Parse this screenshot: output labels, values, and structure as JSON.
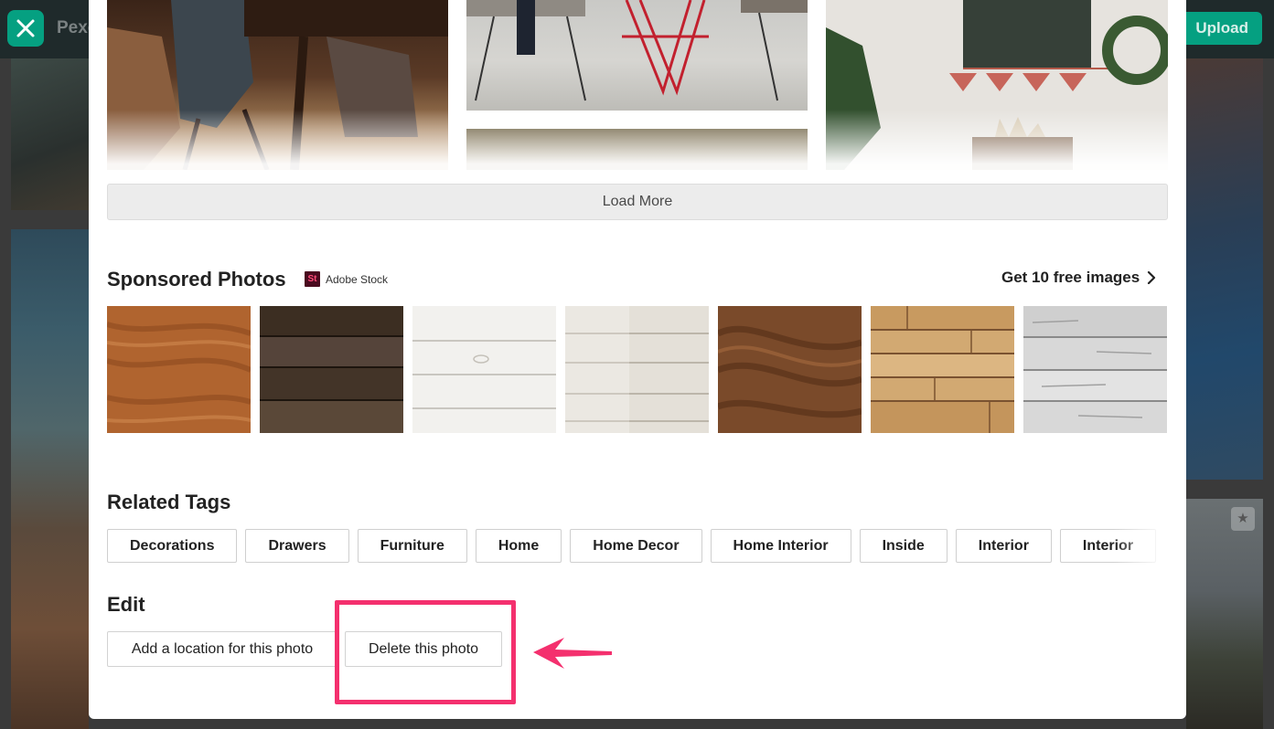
{
  "background": {
    "logo_text": "Pexe",
    "upload_label": "Upload"
  },
  "modal": {
    "close_icon": "close-icon",
    "load_more_label": "Load More",
    "sponsored": {
      "title": "Sponsored Photos",
      "provider_icon_text": "St",
      "provider": "Adobe Stock",
      "cta_label": "Get 10 free images",
      "thumbnails": [
        {
          "label": "warm oak wood texture"
        },
        {
          "label": "dark weathered planks"
        },
        {
          "label": "white painted planks"
        },
        {
          "label": "light grey planks"
        },
        {
          "label": "walnut wood grain"
        },
        {
          "label": "natural pine planks"
        },
        {
          "label": "grey rustic planks"
        }
      ]
    },
    "related_tags": {
      "title": "Related Tags",
      "tags": [
        "Decorations",
        "Drawers",
        "Furniture",
        "Home",
        "Home Decor",
        "Home Interior",
        "Inside",
        "Interior",
        "Interior"
      ]
    },
    "edit": {
      "title": "Edit",
      "add_location_label": "Add a location for this photo",
      "delete_label": "Delete this photo"
    }
  },
  "colors": {
    "brand_green": "#05a081",
    "highlight_pink": "#f4306e",
    "adobe_stock_red": "#ff4c79"
  }
}
